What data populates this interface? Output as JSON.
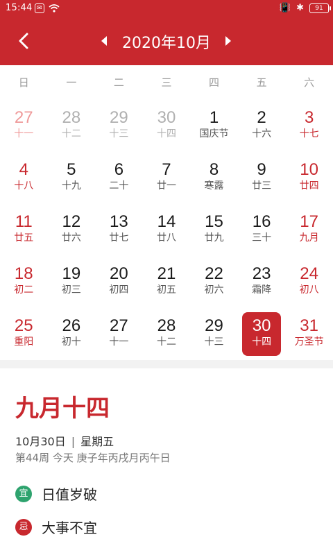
{
  "status_bar": {
    "time": "15:44",
    "battery": "91"
  },
  "header": {
    "month_title": "2020年10月"
  },
  "weekdays": [
    "日",
    "一",
    "二",
    "三",
    "四",
    "五",
    "六"
  ],
  "days": [
    {
      "n": "27",
      "l": "十一"
    },
    {
      "n": "28",
      "l": "十二"
    },
    {
      "n": "29",
      "l": "十三"
    },
    {
      "n": "30",
      "l": "十四"
    },
    {
      "n": "1",
      "l": "国庆节"
    },
    {
      "n": "2",
      "l": "十六"
    },
    {
      "n": "3",
      "l": "十七"
    },
    {
      "n": "4",
      "l": "十八"
    },
    {
      "n": "5",
      "l": "十九"
    },
    {
      "n": "6",
      "l": "二十"
    },
    {
      "n": "7",
      "l": "廿一"
    },
    {
      "n": "8",
      "l": "寒露"
    },
    {
      "n": "9",
      "l": "廿三"
    },
    {
      "n": "10",
      "l": "廿四"
    },
    {
      "n": "11",
      "l": "廿五"
    },
    {
      "n": "12",
      "l": "廿六"
    },
    {
      "n": "13",
      "l": "廿七"
    },
    {
      "n": "14",
      "l": "廿八"
    },
    {
      "n": "15",
      "l": "廿九"
    },
    {
      "n": "16",
      "l": "三十"
    },
    {
      "n": "17",
      "l": "九月"
    },
    {
      "n": "18",
      "l": "初二"
    },
    {
      "n": "19",
      "l": "初三"
    },
    {
      "n": "20",
      "l": "初四"
    },
    {
      "n": "21",
      "l": "初五"
    },
    {
      "n": "22",
      "l": "初六"
    },
    {
      "n": "23",
      "l": "霜降"
    },
    {
      "n": "24",
      "l": "初八"
    },
    {
      "n": "25",
      "l": "重阳"
    },
    {
      "n": "26",
      "l": "初十"
    },
    {
      "n": "27",
      "l": "十一"
    },
    {
      "n": "28",
      "l": "十二"
    },
    {
      "n": "29",
      "l": "十三"
    },
    {
      "n": "30",
      "l": "十四"
    },
    {
      "n": "31",
      "l": "万圣节"
    }
  ],
  "detail": {
    "lunar_date": "九月十四",
    "date": "10月30日",
    "separator": "|",
    "weekday": "星期五",
    "info": "第44周 今天 庚子年丙戌月丙午日",
    "yi_badge": "宜",
    "yi_text": "日值岁破",
    "ji_badge": "忌",
    "ji_text": "大事不宜"
  },
  "colors": {
    "brand_red": "#c8282e",
    "yi_green": "#2ea36e"
  }
}
